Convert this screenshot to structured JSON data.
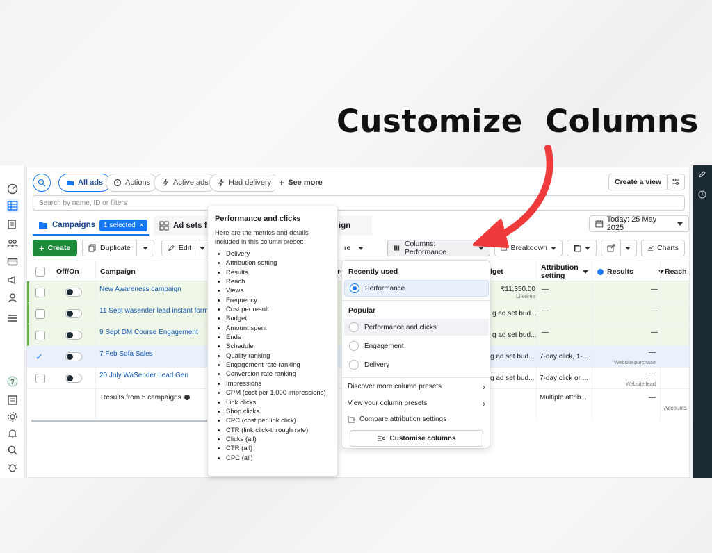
{
  "headline": "Customize  Columns",
  "colors": {
    "accent": "#1877f2",
    "green": "#1d8b3a",
    "arrow": "#ee3a3a",
    "dark_panel": "#1c2b33"
  },
  "filters": {
    "all_ads": "All ads",
    "actions": "Actions",
    "active_ads": "Active ads",
    "had_delivery": "Had delivery",
    "see_more": "See more",
    "create_view": "Create a view"
  },
  "search": {
    "placeholder": "Search by name, ID or filters"
  },
  "tabs": {
    "campaigns": "Campaigns",
    "selected": "1 selected",
    "ad_sets": "Ad sets fo",
    "ads_partial": "ign",
    "date": "Today: 25 May 2025"
  },
  "toolbar": {
    "create": "Create",
    "duplicate": "Duplicate",
    "edit": "Edit",
    "more_partial": "re",
    "columns": "Columns: Performance",
    "breakdown": "Breakdown",
    "charts": "Charts"
  },
  "table": {
    "headers": {
      "offon": "Off/On",
      "campaign": "Campaign",
      "budget_partial": "lget",
      "attribution": "Attribution setting",
      "results": "Results",
      "reach": "Reach",
      "cut": "ro"
    },
    "rows": [
      {
        "name": "New Awareness campaign",
        "budget": "₹11,350.00",
        "budget_sub": "Lifetime",
        "attribution": "—",
        "results": "—",
        "results_sub": ""
      },
      {
        "name": "11 Sept wasender lead instant form",
        "budget": "g ad set bud...",
        "budget_sub": "",
        "attribution": "—",
        "results": "—",
        "results_sub": ""
      },
      {
        "name": "9 Sept DM Course Engagement",
        "budget": "g ad set bud...",
        "budget_sub": "",
        "attribution": "—",
        "results": "—",
        "results_sub": ""
      },
      {
        "name": "7 Feb Sofa Sales",
        "budget": "g ad set bud...",
        "budget_sub": "",
        "attribution": "7-day click, 1-...",
        "results": "—",
        "results_sub": "Website purchase"
      },
      {
        "name": "20 July WaSender Lead Gen",
        "budget": "g ad set bud...",
        "budget_sub": "",
        "attribution": "7-day click or ...",
        "results": "—",
        "results_sub": "Website lead"
      }
    ],
    "footer": {
      "label": "Results from 5 campaigns",
      "attribution": "Multiple attrib...",
      "results": "—",
      "reach": "Accounts"
    }
  },
  "tooltip": {
    "title": "Performance and clicks",
    "description": "Here are the metrics and details included in this column preset:",
    "metrics": [
      "Delivery",
      "Attribution setting",
      "Results",
      "Reach",
      "Views",
      "Frequency",
      "Cost per result",
      "Budget",
      "Amount spent",
      "Ends",
      "Schedule",
      "Quality ranking",
      "Engagement rate ranking",
      "Conversion rate ranking",
      "Impressions",
      "CPM (cost per 1,000 impressions)",
      "Link clicks",
      "Shop clicks",
      "CPC (cost per link click)",
      "CTR (link click-through rate)",
      "Clicks (all)",
      "CTR (all)",
      "CPC (all)"
    ]
  },
  "dropdown": {
    "recently_used": "Recently used",
    "performance": "Performance",
    "popular": "Popular",
    "perf_clicks": "Performance and clicks",
    "engagement": "Engagement",
    "delivery": "Delivery",
    "discover": "Discover more column presets",
    "view_presets": "View your column presets",
    "compare": "Compare attribution settings",
    "customise": "Customise columns"
  }
}
